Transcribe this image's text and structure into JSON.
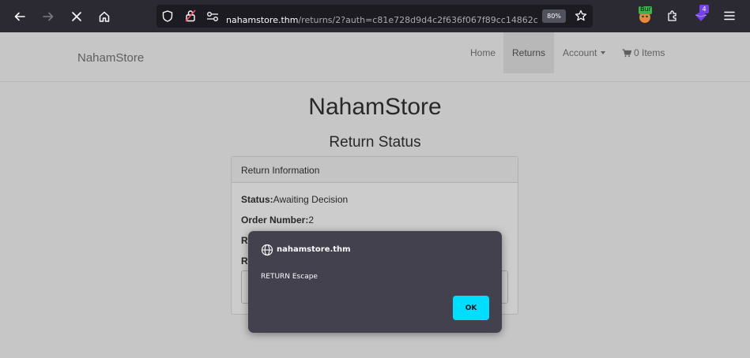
{
  "browser": {
    "url_host": "nahamstore.thm",
    "url_path": "/returns/2?auth=c81e728d9d4c2f636f067f89cc14862c",
    "zoom": "80%",
    "extensions": {
      "burp_label": "Bur",
      "badge_count": "4"
    },
    "colors": {
      "chrome_bg": "#2b2a33",
      "urlbar_bg": "#1c1b22",
      "accent": "#00ddff"
    }
  },
  "site": {
    "brand": "NahamStore",
    "nav": {
      "home": "Home",
      "returns": "Returns",
      "account": "Account",
      "cart": "0 Items"
    },
    "title": "NahamStore",
    "subtitle": "Return Status",
    "panel": {
      "heading": "Return Information",
      "status_label": "Status:",
      "status_value": "Awaiting Decision",
      "order_label": "Order Number:",
      "order_value": "2",
      "row3_label": "R",
      "row4_label": "R"
    }
  },
  "dialog": {
    "host": "nahamstore.thm",
    "message": "RETURN Escape",
    "ok_label": "OK"
  }
}
